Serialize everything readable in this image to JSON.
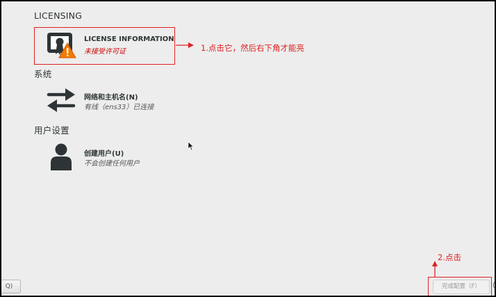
{
  "sections": {
    "licensing": "LICENSING",
    "system": "系统",
    "user_settings": "用户设置"
  },
  "spokes": {
    "license": {
      "title": "LICENSE INFORMATION",
      "status": "未接受许可证",
      "icon": "license-warning-icon"
    },
    "network": {
      "title": "网络和主机名(N)",
      "status": "有线（ens33）已连接",
      "icon": "network-arrows-icon"
    },
    "user": {
      "title": "创建用户(U)",
      "status": "不会创建任何用户",
      "icon": "user-icon"
    }
  },
  "annotations": {
    "step1": "1.点击它，然后右下角才能亮",
    "step2": "2.点击"
  },
  "buttons": {
    "left_partial": "Q)",
    "finish": "完成配置（F）",
    "edge": "("
  },
  "colors": {
    "annotation_red": "#e02020",
    "warning_orange": "#f57900",
    "background": "#ededed"
  }
}
